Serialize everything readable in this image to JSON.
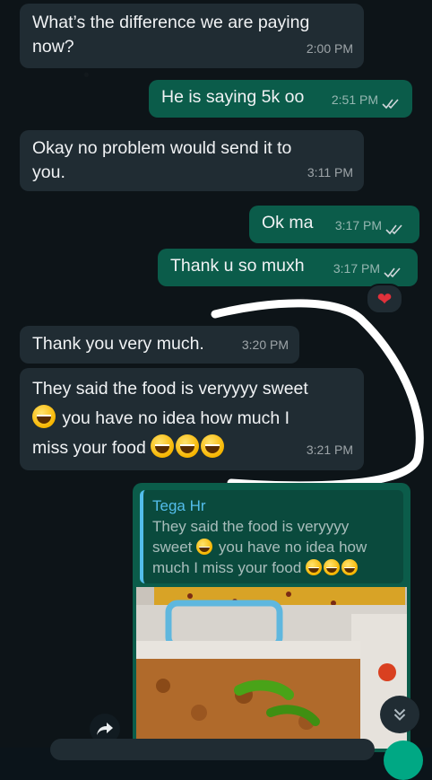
{
  "messages": [
    {
      "text_line1": "What’s the difference we are paying",
      "text_line2": "now?",
      "time": "2:00 PM"
    },
    {
      "text": "He is saying 5k oo",
      "time": "2:51 PM"
    },
    {
      "text_line1": "Okay no problem would send it to",
      "text_line2": "you.",
      "time": "3:11 PM"
    },
    {
      "text": "Ok ma",
      "time": "3:17 PM"
    },
    {
      "text": "Thank u so muxh",
      "time": "3:17 PM",
      "reaction": "❤"
    },
    {
      "text": "Thank you very much.",
      "time": "3:20 PM"
    },
    {
      "text_line1": "They said the food is veryyyy sweet",
      "text_line2": "you have no idea how much I",
      "text_line3": "miss your food",
      "time": "3:21 PM"
    }
  ],
  "reply": {
    "quote_author": "Tega Hr",
    "quote_line1": "They said the food is veryyyy",
    "quote_line2a": "sweet",
    "quote_line2b": "you have no idea how",
    "quote_line3": "much I miss your food"
  },
  "icons": {
    "forward": "forward-icon",
    "scroll_down": "chevron-double-down-icon",
    "read_receipt": "double-check-icon",
    "heart": "heart-icon",
    "emoji": "grinning-emoji-icon"
  },
  "colors": {
    "incoming": "#202c33",
    "outgoing": "#0b5c4a",
    "author": "#53bdeb",
    "background": "#0d1418"
  }
}
